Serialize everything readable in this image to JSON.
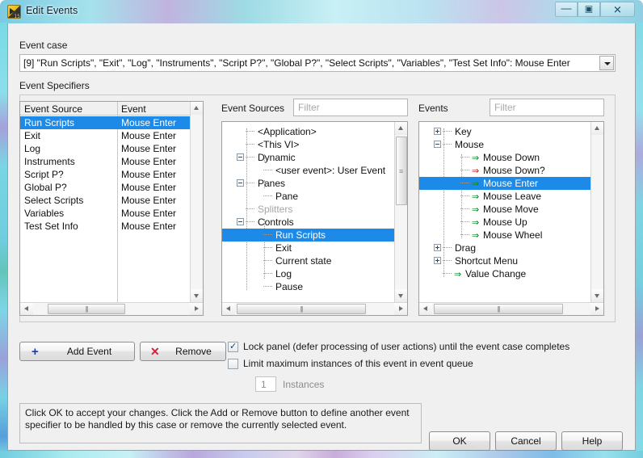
{
  "window": {
    "title": "Edit Events",
    "icon": "labview-icon",
    "buttons": {
      "minimize": "—",
      "maximize": "▣",
      "close": "✕"
    }
  },
  "event_case": {
    "label": "Event case",
    "value": "[9] \"Run Scripts\", \"Exit\", \"Log\", \"Instruments\", \"Script P?\", \"Global P?\", \"Select Scripts\", \"Variables\", \"Test Set Info\": Mouse Enter",
    "dropdown_icon": "chevron-down-icon"
  },
  "specifiers": {
    "label": "Event Specifiers",
    "columns": [
      "Event Source",
      "Event"
    ],
    "rows": [
      {
        "source": "Run Scripts",
        "event": "Mouse Enter",
        "selected": true
      },
      {
        "source": "Exit",
        "event": "Mouse Enter",
        "selected": false
      },
      {
        "source": "Log",
        "event": "Mouse Enter",
        "selected": false
      },
      {
        "source": "Instruments",
        "event": "Mouse Enter",
        "selected": false
      },
      {
        "source": "Script P?",
        "event": "Mouse Enter",
        "selected": false
      },
      {
        "source": "Global P?",
        "event": "Mouse Enter",
        "selected": false
      },
      {
        "source": "Select Scripts",
        "event": "Mouse Enter",
        "selected": false
      },
      {
        "source": "Variables",
        "event": "Mouse Enter",
        "selected": false
      },
      {
        "source": "Test Set Info",
        "event": "Mouse Enter",
        "selected": false
      }
    ]
  },
  "event_sources": {
    "label": "Event Sources",
    "filter_placeholder": "Filter",
    "nodes": [
      {
        "label": "<Application>",
        "depth": 1,
        "expander": "none",
        "arrow": "none",
        "selected": false,
        "dim": false
      },
      {
        "label": "<This VI>",
        "depth": 1,
        "expander": "none",
        "arrow": "none",
        "selected": false,
        "dim": false
      },
      {
        "label": "Dynamic",
        "depth": 1,
        "expander": "minus",
        "arrow": "none",
        "selected": false,
        "dim": false
      },
      {
        "label": "<user event>: User Event",
        "depth": 2,
        "expander": "none",
        "arrow": "none",
        "selected": false,
        "dim": false
      },
      {
        "label": "Panes",
        "depth": 1,
        "expander": "minus",
        "arrow": "none",
        "selected": false,
        "dim": false
      },
      {
        "label": "Pane",
        "depth": 2,
        "expander": "none",
        "arrow": "none",
        "selected": false,
        "dim": false
      },
      {
        "label": "Splitters",
        "depth": 1,
        "expander": "none",
        "arrow": "none",
        "selected": false,
        "dim": true
      },
      {
        "label": "Controls",
        "depth": 1,
        "expander": "minus",
        "arrow": "none",
        "selected": false,
        "dim": false
      },
      {
        "label": "Run Scripts",
        "depth": 2,
        "expander": "none",
        "arrow": "none",
        "selected": true,
        "dim": false
      },
      {
        "label": "Exit",
        "depth": 2,
        "expander": "none",
        "arrow": "none",
        "selected": false,
        "dim": false
      },
      {
        "label": "Current state",
        "depth": 2,
        "expander": "none",
        "arrow": "none",
        "selected": false,
        "dim": false
      },
      {
        "label": "Log",
        "depth": 2,
        "expander": "none",
        "arrow": "none",
        "selected": false,
        "dim": false
      },
      {
        "label": "Pause",
        "depth": 2,
        "expander": "none",
        "arrow": "none",
        "selected": false,
        "dim": false
      }
    ]
  },
  "events": {
    "label": "Events",
    "filter_placeholder": "Filter",
    "nodes": [
      {
        "label": "Key",
        "depth": 1,
        "expander": "plus",
        "arrow": "none",
        "selected": false
      },
      {
        "label": "Mouse",
        "depth": 1,
        "expander": "minus",
        "arrow": "none",
        "selected": false
      },
      {
        "label": "Mouse Down",
        "depth": 2,
        "expander": "none",
        "arrow": "notify",
        "selected": false
      },
      {
        "label": "Mouse Down?",
        "depth": 2,
        "expander": "none",
        "arrow": "filter",
        "selected": false
      },
      {
        "label": "Mouse Enter",
        "depth": 2,
        "expander": "none",
        "arrow": "notify",
        "selected": true
      },
      {
        "label": "Mouse Leave",
        "depth": 2,
        "expander": "none",
        "arrow": "notify",
        "selected": false
      },
      {
        "label": "Mouse Move",
        "depth": 2,
        "expander": "none",
        "arrow": "notify",
        "selected": false
      },
      {
        "label": "Mouse Up",
        "depth": 2,
        "expander": "none",
        "arrow": "notify",
        "selected": false
      },
      {
        "label": "Mouse Wheel",
        "depth": 2,
        "expander": "none",
        "arrow": "notify",
        "selected": false
      },
      {
        "label": "Drag",
        "depth": 1,
        "expander": "plus",
        "arrow": "none",
        "selected": false
      },
      {
        "label": "Shortcut Menu",
        "depth": 1,
        "expander": "plus",
        "arrow": "none",
        "selected": false
      },
      {
        "label": "Value Change",
        "depth": 1,
        "expander": "none",
        "arrow": "notify",
        "selected": false
      }
    ]
  },
  "actions": {
    "add_event": "Add Event",
    "add_event_icon": "plus-icon",
    "remove": "Remove",
    "remove_icon": "x-icon"
  },
  "options": {
    "lock_panel": {
      "label": "Lock panel (defer processing of user actions) until the event case completes",
      "checked": true
    },
    "limit_instances": {
      "label": "Limit maximum instances of this event in event queue",
      "checked": false
    },
    "instances_value": "1",
    "instances_label": "Instances"
  },
  "info": {
    "text": "Click OK to accept your changes.  Click the Add or Remove button to define another event specifier to be handled by this case or remove the currently selected event."
  },
  "dialog_buttons": {
    "ok": "OK",
    "cancel": "Cancel",
    "help": "Help"
  },
  "colors": {
    "selection": "#1e8ae8",
    "notify_arrow": "#0a8a2a",
    "filter_arrow": "#c02020",
    "dialog_bg": "#f0f0f0"
  }
}
